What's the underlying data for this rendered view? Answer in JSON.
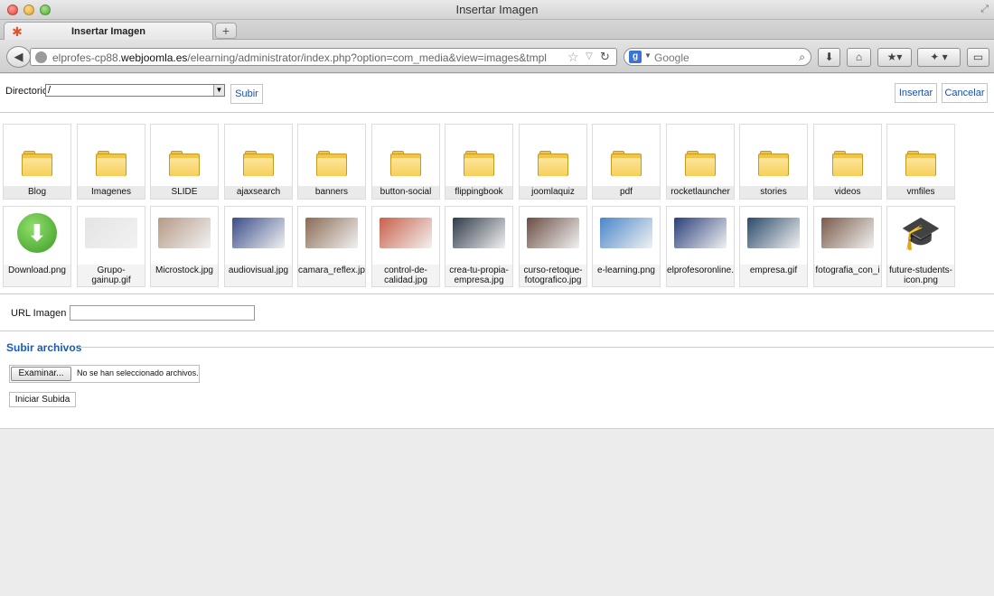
{
  "window": {
    "title": "Insertar Imagen"
  },
  "tab": {
    "label": "Insertar Imagen"
  },
  "nav": {
    "url_prefix": "elprofes-cp88.",
    "url_host": "webjoomla.es",
    "url_suffix": "/elearning/administrator/index.php?option=com_media&view=images&tmpl",
    "search_placeholder": "Google"
  },
  "toolbar": {
    "dir_label": "Directorio",
    "dir_value": "/",
    "upload_button": "Subir",
    "insert_button": "Insertar",
    "cancel_button": "Cancelar"
  },
  "folders": [
    "Blog",
    "Imagenes",
    "SLIDE",
    "ajaxsearch",
    "banners",
    "button-social",
    "flippingbook",
    "joomlaquiz",
    "pdf",
    "rocketlauncher",
    "stories",
    "videos",
    "vmfiles"
  ],
  "files": [
    {
      "name": "Download.png",
      "color": "#4aa832"
    },
    {
      "name": "Grupo-gainup.gif",
      "color": "#e4e4e4"
    },
    {
      "name": "Microstock.jpg",
      "color": "#b59a86"
    },
    {
      "name": "audiovisual.jpg",
      "color": "#3a4d8a"
    },
    {
      "name": "camara_reflex.jp",
      "color": "#8a6b55"
    },
    {
      "name": "control-de-calidad.jpg",
      "color": "#c9604a"
    },
    {
      "name": "crea-tu-propia-empresa.jpg",
      "color": "#2f3a4a"
    },
    {
      "name": "curso-retoque-fotografico.jpg",
      "color": "#6b4e44"
    },
    {
      "name": "e-learning.png",
      "color": "#4a86c9"
    },
    {
      "name": "elprofesoronline.",
      "color": "#2a3f7a"
    },
    {
      "name": "empresa.gif",
      "color": "#2a4a6a"
    },
    {
      "name": "fotografia_con_i",
      "color": "#7a5a4a"
    },
    {
      "name": "future-students-icon.png",
      "color": "#2b4f7a"
    }
  ],
  "url_field": {
    "label": "URL Imagen",
    "value": ""
  },
  "upload": {
    "title": "Subir archivos",
    "browse_button": "Examinar...",
    "no_file_text": "No se han seleccionado archivos.",
    "start_button": "Iniciar Subida"
  }
}
